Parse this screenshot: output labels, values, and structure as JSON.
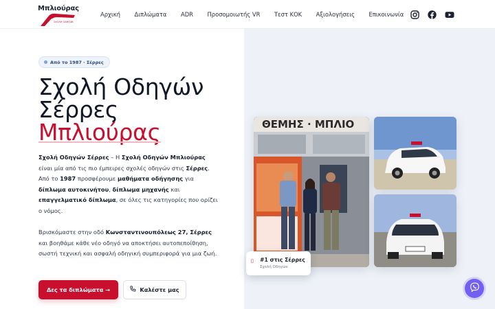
{
  "brand": {
    "name": "Μπλιούρας",
    "sub": "ΣΧΟΛΗ ΟΔΗΓΩΝ"
  },
  "nav": {
    "items": [
      "Αρχική",
      "Διπλώματα",
      "ADR",
      "Προσομοιωτής VR",
      "Τεστ ΚΟΚ",
      "Αξιολογήσεις",
      "Επικοινωνία"
    ]
  },
  "socials": [
    "instagram-icon",
    "facebook-icon",
    "youtube-icon"
  ],
  "hero": {
    "badge": "Από το 1987 · Σέρρες",
    "title_line1": "Σχολή Οδηγών",
    "title_line2": "Σέρρες",
    "title_line3": "Μπλιούρας",
    "cta_primary": "Δες τα διπλώματα →",
    "cta_secondary": "Καλέστε μας"
  },
  "card": {
    "title": "#1 στις Σέρρες",
    "subtitle": "Σχολή Οδηγών"
  },
  "colors": {
    "accent": "#c8102e",
    "viber": "#7360f2",
    "hero_bg": "#eef2f8"
  }
}
